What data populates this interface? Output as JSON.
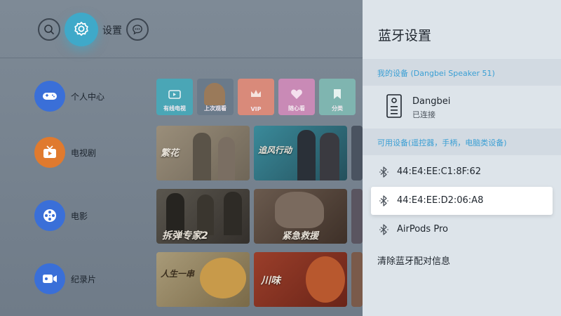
{
  "header": {
    "settings_label": "设置"
  },
  "sidebar": {
    "items": [
      {
        "label": "个人中心",
        "icon": "gamepad-icon",
        "color": "#3a6fd8"
      },
      {
        "label": "电视剧",
        "icon": "tv-icon",
        "color": "#e07a2e"
      },
      {
        "label": "电影",
        "icon": "film-reel-icon",
        "color": "#3a6fd8"
      },
      {
        "label": "纪录片",
        "icon": "video-camera-icon",
        "color": "#3a6fd8"
      }
    ]
  },
  "quick_tiles": [
    {
      "label": "有线电视",
      "color": "#4aa6b6"
    },
    {
      "label": "上次观看",
      "color": "#6a7a8a"
    },
    {
      "label": "VIP",
      "color": "#d98a7a"
    },
    {
      "label": "随心看",
      "color": "#c98ab6"
    },
    {
      "label": "分类",
      "color": "#7fb5b0"
    }
  ],
  "posters": {
    "row1": [
      {
        "title": "繁花",
        "color": "#8a8070"
      },
      {
        "title": "追风行动",
        "color": "#2f6a7a"
      },
      {
        "title": "",
        "color": "#4a5360"
      }
    ],
    "row2": [
      {
        "title": "拆弹专家2",
        "color": "#44403a"
      },
      {
        "title": "紧急救援",
        "color": "#5a4840"
      }
    ],
    "row3": [
      {
        "title": "人生一串",
        "color": "#8a7a5a"
      },
      {
        "title": "川味",
        "color": "#8a3a2a"
      }
    ]
  },
  "panel": {
    "title": "蓝牙设置",
    "my_devices_header": "我的设备 (Dangbei Speaker 51)",
    "connected_device": {
      "name": "Dangbei",
      "status": "已连接",
      "icon": "speaker-icon"
    },
    "available_header": "可用设备(遥控器，手柄，电脑类设备)",
    "available_devices": [
      {
        "name": "44:E4:EE:C1:8F:62",
        "selected": false
      },
      {
        "name": "44:E4:EE:D2:06:A8",
        "selected": true
      },
      {
        "name": "AirPods Pro",
        "selected": false
      }
    ],
    "clear_label": "清除蓝牙配对信息"
  },
  "colors": {
    "accent": "#3fa9c9",
    "section_text": "#3a9fd4",
    "panel_bg": "#dde4ea"
  }
}
